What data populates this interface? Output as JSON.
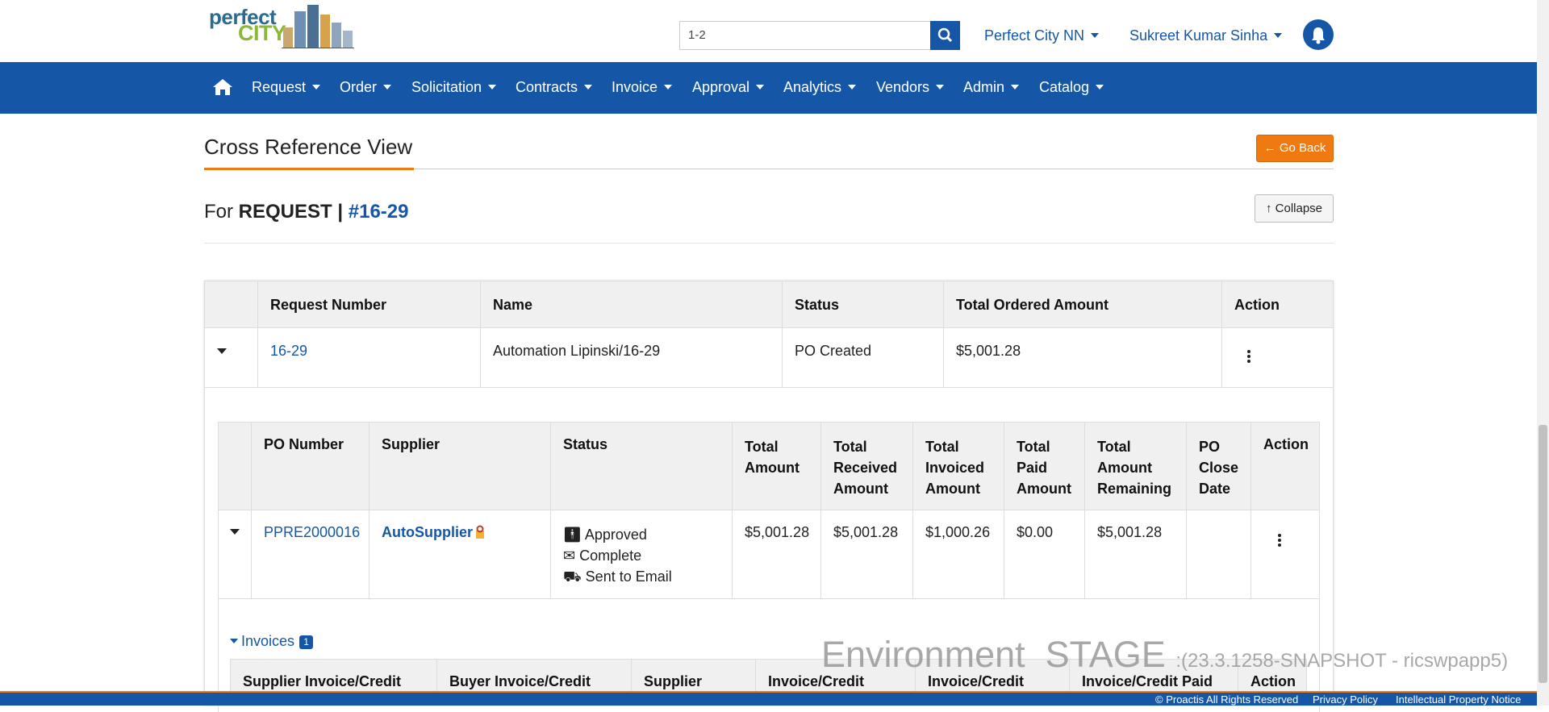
{
  "header": {
    "logo_word1": "perfect",
    "logo_word2": "CITY",
    "search_value": "1-2",
    "org": "Perfect City NN",
    "user": "Sukreet Kumar Sinha"
  },
  "nav": {
    "items": [
      "Request",
      "Order",
      "Solicitation",
      "Contracts",
      "Invoice",
      "Approval",
      "Analytics",
      "Vendors",
      "Admin",
      "Catalog"
    ]
  },
  "page": {
    "title": "Cross Reference View",
    "go_back": "Go Back",
    "for_prefix": "For",
    "for_type": "REQUEST",
    "for_sep": "|",
    "for_number": "#16-29",
    "collapse": "Collapse"
  },
  "request_table": {
    "headers": [
      "Request Number",
      "Name",
      "Status",
      "Total Ordered Amount",
      "Action"
    ],
    "row": {
      "number": "16-29",
      "name": "Automation Lipinski/16-29",
      "status": "PO Created",
      "total": "$5,001.28"
    }
  },
  "po_table": {
    "headers": {
      "po_number": "PO Number",
      "supplier": "Supplier",
      "status": "Status",
      "total1": "Total",
      "total2": "Amount",
      "recv1": "Total",
      "recv2": "Received",
      "recv3": "Amount",
      "inv1": "Total",
      "inv2": "Invoiced",
      "inv3": "Amount",
      "paid1": "Total",
      "paid2": "Paid",
      "paid3": "Amount",
      "rem1": "Total",
      "rem2": "Amount",
      "rem3": "Remaining",
      "close1": "PO",
      "close2": "Close",
      "close3": "Date",
      "action": "Action"
    },
    "row": {
      "po_number": "PPRE2000016",
      "supplier": "AutoSupplier",
      "status_approved": "Approved",
      "status_complete": "Complete",
      "status_sent": "Sent to Email",
      "total_amount": "$5,001.28",
      "total_received": "$5,001.28",
      "total_invoiced": "$1,000.26",
      "total_paid": "$0.00",
      "total_remaining": "$5,001.28",
      "close_date": ""
    }
  },
  "invoices": {
    "label": "Invoices",
    "count": "1",
    "headers": [
      "Supplier Invoice/Credit",
      "Buyer Invoice/Credit",
      "Supplier",
      "Invoice/Credit",
      "Invoice/Credit",
      "Invoice/Credit Paid",
      "Action"
    ]
  },
  "environment": {
    "label": "Environment  STAGE",
    "detail": ":(23.3.1258-SNAPSHOT - ricswpapp5)"
  },
  "footer": {
    "copyright": "© Proactis All Rights Reserved",
    "privacy": "Privacy Policy",
    "ip": "Intellectual Property Notice"
  },
  "colors": {
    "primary": "#1557a6",
    "accent": "#f07a10"
  }
}
